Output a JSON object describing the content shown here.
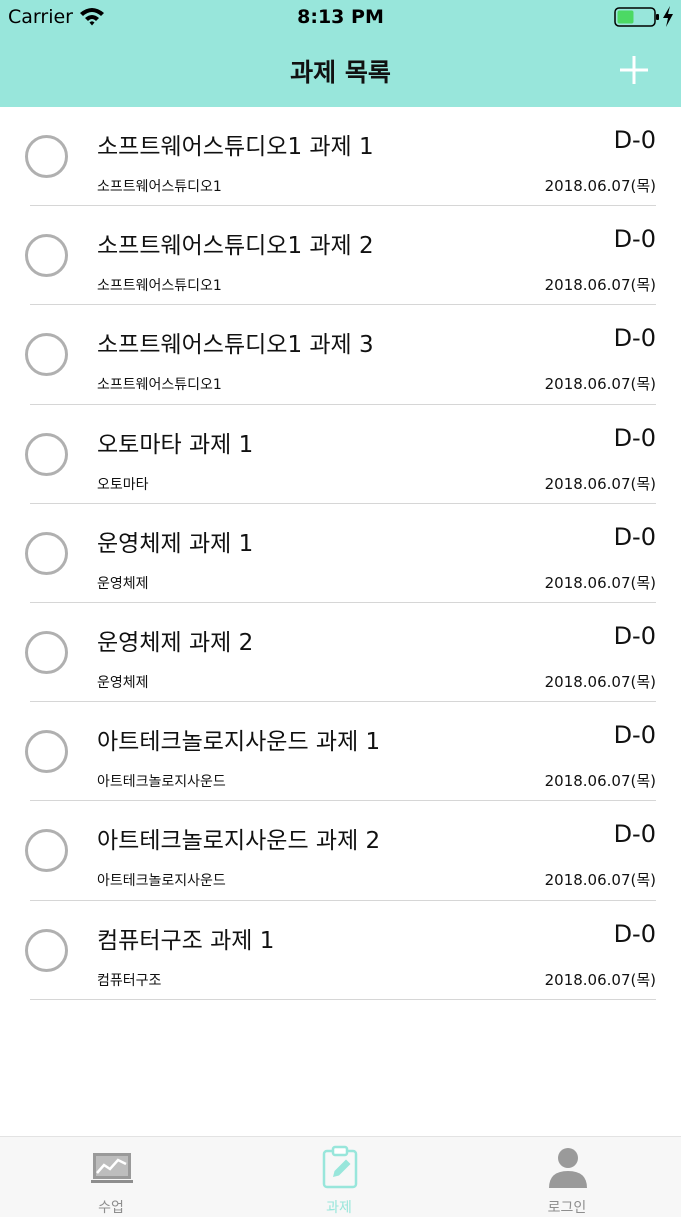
{
  "status_bar": {
    "carrier": "Carrier",
    "time": "8:13 PM"
  },
  "nav": {
    "title": "과제 목록",
    "add_icon": "plus-icon"
  },
  "colors": {
    "accent": "#98e6db",
    "inactive": "#8e8e8e",
    "circle": "#b0b0b0"
  },
  "assignments": [
    {
      "title": "소프트웨어스튜디오1 과제 1",
      "dday": "D-0",
      "course": "소프트웨어스튜디오1",
      "date": "2018.06.07(목)"
    },
    {
      "title": "소프트웨어스튜디오1 과제 2",
      "dday": "D-0",
      "course": "소프트웨어스튜디오1",
      "date": "2018.06.07(목)"
    },
    {
      "title": "소프트웨어스튜디오1 과제 3",
      "dday": "D-0",
      "course": "소프트웨어스튜디오1",
      "date": "2018.06.07(목)"
    },
    {
      "title": "오토마타 과제 1",
      "dday": "D-0",
      "course": "오토마타",
      "date": "2018.06.07(목)"
    },
    {
      "title": "운영체제 과제 1",
      "dday": "D-0",
      "course": "운영체제",
      "date": "2018.06.07(목)"
    },
    {
      "title": "운영체제 과제 2",
      "dday": "D-0",
      "course": "운영체제",
      "date": "2018.06.07(목)"
    },
    {
      "title": "아트테크놀로지사운드 과제 1",
      "dday": "D-0",
      "course": "아트테크놀로지사운드",
      "date": "2018.06.07(목)"
    },
    {
      "title": "아트테크놀로지사운드 과제 2",
      "dday": "D-0",
      "course": "아트테크놀로지사운드",
      "date": "2018.06.07(목)"
    },
    {
      "title": "컴퓨터구조 과제 1",
      "dday": "D-0",
      "course": "컴퓨터구조",
      "date": "2018.06.07(목)"
    }
  ],
  "tabbar": {
    "tabs": [
      {
        "label": "수업",
        "icon": "chart-icon",
        "active": false
      },
      {
        "label": "과제",
        "icon": "clipboard-pencil-icon",
        "active": true
      },
      {
        "label": "로그인",
        "icon": "person-icon",
        "active": false
      }
    ]
  }
}
